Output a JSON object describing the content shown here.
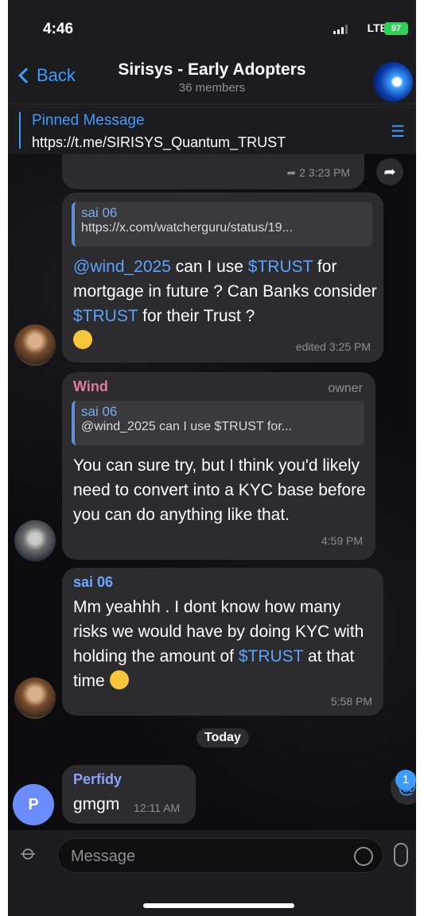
{
  "status": {
    "time": "4:46",
    "network": "LTE",
    "battery": "97"
  },
  "header": {
    "back_label": "Back",
    "title": "Sirisys - Early Adopters",
    "subtitle": "36 members"
  },
  "pinned": {
    "title": "Pinned Message",
    "text": "https://t.me/SIRISYS_Quantum_TRUST"
  },
  "messages": [
    {
      "replies": "2",
      "time": "3:23 PM"
    },
    {
      "reply_to": {
        "name": "sai 06",
        "text": "https://x.com/watcherguru/status/19..."
      },
      "parts": [
        "@wind_2025",
        " can I use ",
        "$TRUST",
        " for mortgage in future ? Can Banks consider ",
        "$TRUST",
        " for their Trust ?"
      ],
      "meta": "edited 3:25 PM"
    },
    {
      "sender": "Wind",
      "role": "owner",
      "reply_to": {
        "name": "sai 06",
        "text": "@wind_2025 can I use $TRUST for..."
      },
      "text": "You can sure try, but I think you'd likely need to convert into a KYC base before you can do anything like that.",
      "time": "4:59 PM"
    },
    {
      "sender": "sai 06",
      "parts": [
        "Mm yeahhh . I dont know how many risks we would have by doing KYC with holding the amount of ",
        "$TRUST",
        " at that time"
      ],
      "time": "5:58 PM"
    },
    {
      "sender": "Perfidy",
      "avatar_letter": "P",
      "text": "gmgm",
      "time": "12:11 AM"
    }
  ],
  "date_separator": "Today",
  "mention_badge": "1",
  "input": {
    "placeholder": "Message"
  },
  "icons": [
    "chevron-left-icon",
    "pin-list-icon",
    "forward-icon",
    "reply-arrow-icon",
    "mention-icon",
    "attach-icon",
    "sticker-icon",
    "mic-icon"
  ]
}
